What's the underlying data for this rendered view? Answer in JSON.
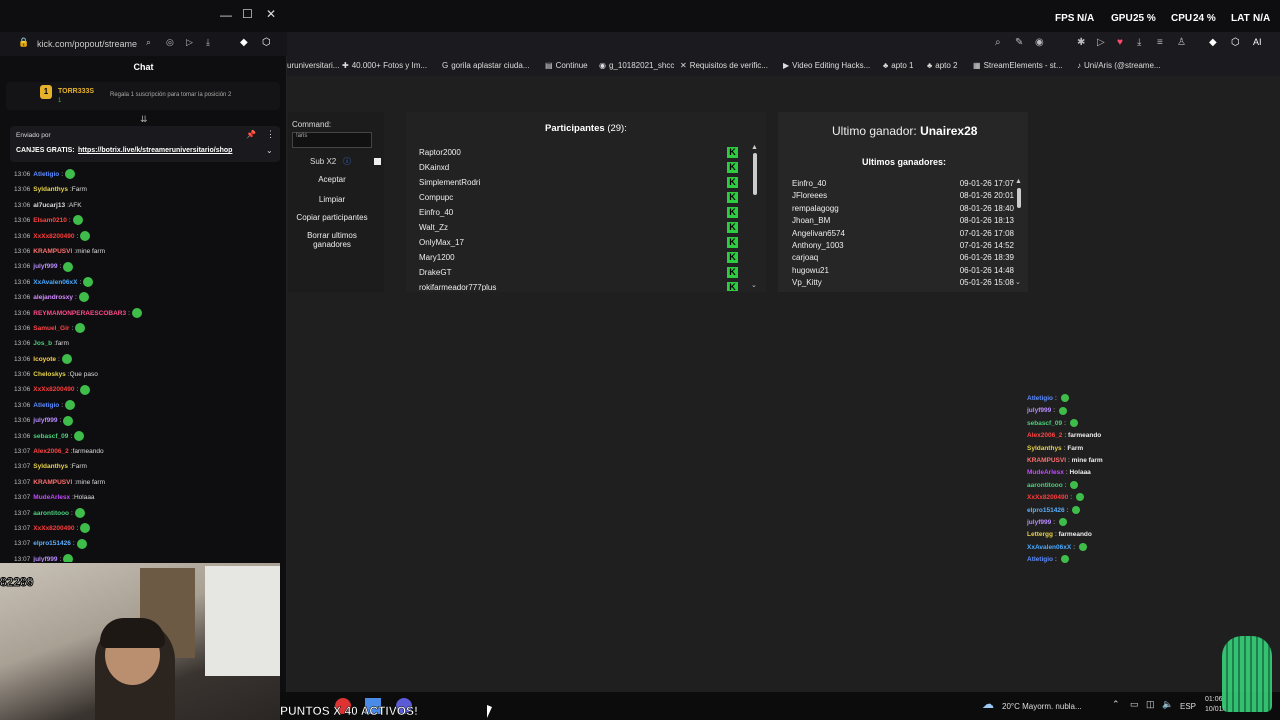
{
  "popout": {
    "url": "kick.com/popout/streame",
    "chat_header": "Chat",
    "pinned": {
      "user": "TORR333S",
      "count": "1",
      "text": "Regala 1 suscripción para tomar la posición 2"
    },
    "banner": {
      "sent_by": "Enviado por",
      "canjes_label": "CANJES GRATIS:",
      "canjes_link": "https://botrix.live/k/streameruniversitario/shop"
    },
    "messages": [
      {
        "time": "13:06",
        "user": "Atletigio",
        "color": "#5b8cff",
        "text": "",
        "emote": true
      },
      {
        "time": "13:06",
        "user": "Syldanthys",
        "color": "#e6d24a",
        "text": "Farm",
        "emote": false
      },
      {
        "time": "13:06",
        "user": "al7ucarj13",
        "color": "#dddddd",
        "text": "AFK",
        "emote": false
      },
      {
        "time": "13:06",
        "user": "Elsam0210",
        "color": "#ff4444",
        "text": "",
        "emote": true
      },
      {
        "time": "13:06",
        "user": "XxXx8200490",
        "color": "#ff3b3b",
        "text": "",
        "emote": true
      },
      {
        "time": "13:06",
        "user": "KRAMPUSVI",
        "color": "#ff7070",
        "text": "mine farm",
        "emote": false
      },
      {
        "time": "13:06",
        "user": "julyf999",
        "color": "#b98cff",
        "text": "",
        "emote": true
      },
      {
        "time": "13:06",
        "user": "XxAvalen06xX",
        "color": "#4aa8ff",
        "text": "",
        "emote": true
      },
      {
        "time": "13:06",
        "user": "alejandrosxy",
        "color": "#d48cff",
        "text": "",
        "emote": true
      },
      {
        "time": "13:06",
        "user": "REYMAMONPERAESCOBAR3",
        "color": "#ff4a8c",
        "text": "",
        "emote": true
      },
      {
        "time": "13:06",
        "user": "Samuel_Gir",
        "color": "#ff4444",
        "text": "",
        "emote": true
      },
      {
        "time": "13:06",
        "user": "Jos_b",
        "color": "#4ad17a",
        "text": "farm",
        "emote": false
      },
      {
        "time": "13:06",
        "user": "lcoyote",
        "color": "#ffd24a",
        "text": "",
        "emote": true
      },
      {
        "time": "13:06",
        "user": "Cheloskys",
        "color": "#e6d24a",
        "text": "Que paso",
        "emote": false
      },
      {
        "time": "13:06",
        "user": "XxXx8200490",
        "color": "#ff3b3b",
        "text": "",
        "emote": true
      },
      {
        "time": "13:06",
        "user": "Atletigio",
        "color": "#5b8cff",
        "text": "",
        "emote": true
      },
      {
        "time": "13:06",
        "user": "julyf999",
        "color": "#b98cff",
        "text": "",
        "emote": true
      },
      {
        "time": "13:06",
        "user": "sebascf_09",
        "color": "#4ad17a",
        "text": "",
        "emote": true
      },
      {
        "time": "13:07",
        "user": "Alex2006_2",
        "color": "#ff4444",
        "text": "farmeando",
        "emote": false
      },
      {
        "time": "13:07",
        "user": "Syldanthys",
        "color": "#e6d24a",
        "text": "Farm",
        "emote": false
      },
      {
        "time": "13:07",
        "user": "KRAMPUSVI",
        "color": "#ff7070",
        "text": "mine farm",
        "emote": false
      },
      {
        "time": "13:07",
        "user": "MudeArlesx",
        "color": "#c34aff",
        "text": "Holaaa",
        "emote": false
      },
      {
        "time": "13:07",
        "user": "aarontitooo",
        "color": "#4ad17a",
        "text": "",
        "emote": true
      },
      {
        "time": "13:07",
        "user": "XxXx8200490",
        "color": "#ff3b3b",
        "text": "",
        "emote": true
      },
      {
        "time": "13:07",
        "user": "elpro151426",
        "color": "#5bb0ff",
        "text": "",
        "emote": true
      },
      {
        "time": "13:07",
        "user": "julyf999",
        "color": "#b98cff",
        "text": "",
        "emote": true
      }
    ]
  },
  "cam": {
    "counter": "82289"
  },
  "system": {
    "fps_label": "FPS",
    "fps_value": "N/A",
    "gpu_label": "GPU",
    "gpu_value": "25 %",
    "cpu_label": "CPU",
    "cpu_value": "24 %",
    "lat_label": "LAT",
    "lat_value": "N/A"
  },
  "bookmarks": [
    "uruniversitari...",
    "40.000+ Fotos y Im...",
    "gorila aplastar ciuda...",
    "Continue",
    "g_10182021_shcc",
    "Requisitos de verific...",
    "Video Editing Hacks...",
    "apto 1",
    "apto 2",
    "StreamElements - st...",
    "Uni/Aris (@streame..."
  ],
  "commands": {
    "command_label": "Command:",
    "command_value": "!aris",
    "sub_label": "Sub X2",
    "accept": "Aceptar",
    "clear": "Limpiar",
    "copy": "Copiar participantes",
    "delete": "Borrar ultimos ganadores"
  },
  "participants": {
    "title": "Participantes",
    "count": "(29):",
    "names": [
      "Raptor2000",
      "DKainxd",
      "SimplementRodri",
      "Compupc",
      "Einfro_40",
      "Walt_Zz",
      "OnlyMax_17",
      "Mary1200",
      "DrakeGT",
      "rokifarmeador777plus"
    ]
  },
  "winners": {
    "last_label": "Ultimo ganador:",
    "last_name": "Unairex28",
    "list_title": "Ultimos ganadores:",
    "rows": [
      {
        "name": "Einfro_40",
        "date": "09-01-26 17:07"
      },
      {
        "name": "JFloreees",
        "date": "08-01-26 20:01"
      },
      {
        "name": "rempalagogg",
        "date": "08-01-26 18:40"
      },
      {
        "name": "Jhoan_BM",
        "date": "08-01-26 18:13"
      },
      {
        "name": "Angelivan6574",
        "date": "07-01-26 17:08"
      },
      {
        "name": "Anthony_1003",
        "date": "07-01-26 14:52"
      },
      {
        "name": "carjoaq",
        "date": "06-01-26 18:39"
      },
      {
        "name": "hugowu21",
        "date": "06-01-26 14:48"
      },
      {
        "name": "Vp_Kitty",
        "date": "05-01-26 15:08"
      }
    ]
  },
  "overlay_chat": [
    {
      "user": "Atletigio",
      "color": "#5b8cff",
      "text": "",
      "emote": true
    },
    {
      "user": "julyf999",
      "color": "#b98cff",
      "text": "",
      "emote": true
    },
    {
      "user": "sebascf_09",
      "color": "#4ad17a",
      "text": "",
      "emote": true
    },
    {
      "user": "Alex2006_2",
      "color": "#ff4444",
      "text": "farmeando",
      "emote": false
    },
    {
      "user": "Syldanthys",
      "color": "#e6d24a",
      "text": "Farm",
      "emote": false
    },
    {
      "user": "KRAMPUSVI",
      "color": "#ff7070",
      "text": "mine farm",
      "emote": false
    },
    {
      "user": "MudeArlesx",
      "color": "#c34aff",
      "text": "Holaaa",
      "emote": false
    },
    {
      "user": "aarontitooo",
      "color": "#4ad17a",
      "text": "",
      "emote": true
    },
    {
      "user": "XxXx8200490",
      "color": "#ff3b3b",
      "text": "",
      "emote": true
    },
    {
      "user": "elpro151426",
      "color": "#5bb0ff",
      "text": "",
      "emote": true
    },
    {
      "user": "julyf999",
      "color": "#b98cff",
      "text": "",
      "emote": true
    },
    {
      "user": "Lettergg",
      "color": "#e6d24a",
      "text": "farmeando",
      "emote": false
    },
    {
      "user": "XxAvalen06xX",
      "color": "#4aa8ff",
      "text": "",
      "emote": true
    },
    {
      "user": "Atletigio",
      "color": "#5b8cff",
      "text": "",
      "emote": true
    }
  ],
  "overlay_text": "PUNTOS X 40 ACTIVOS!",
  "taskbar": {
    "weather": "20°C Mayorm. nubla...",
    "lang": "ESP",
    "time": "01:06",
    "date": "10/01/..."
  }
}
